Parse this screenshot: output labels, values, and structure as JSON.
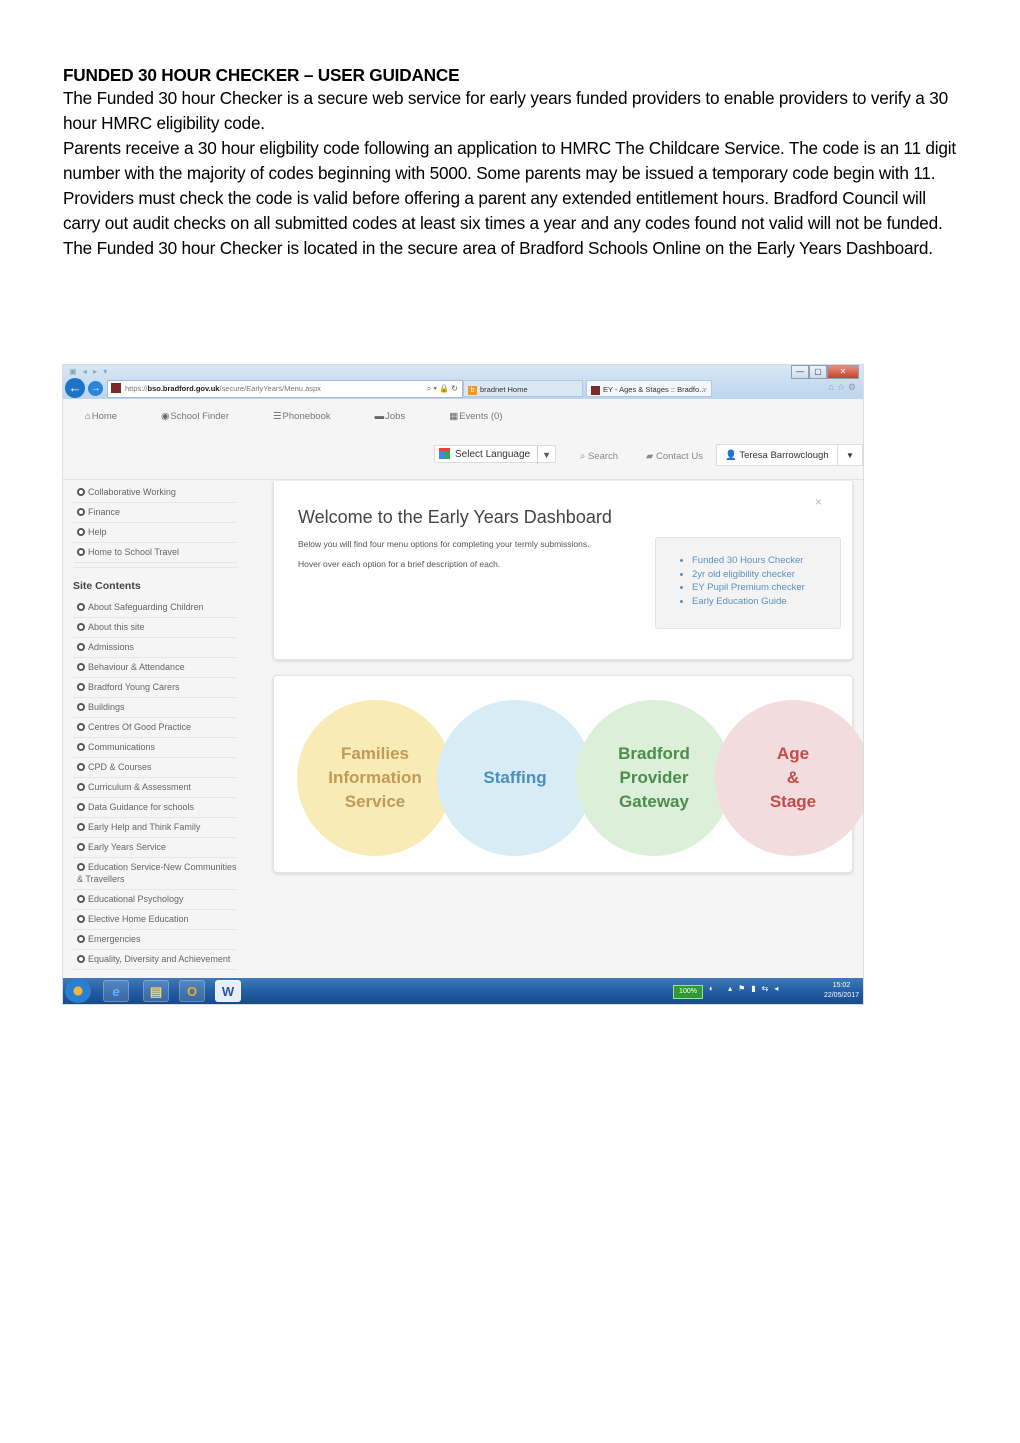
{
  "document": {
    "heading": "FUNDED 30 HOUR CHECKER – USER GUIDANCE",
    "paragraphs": [
      "The Funded 30 hour Checker is a secure web service for early years funded providers to enable providers to verify a 30 hour HMRC eligibility code.",
      "Parents receive a 30 hour eligbility code following an application to HMRC The Childcare Service. The code is an 11 digit number with the majority of codes beginning with 5000. Some parents may be issued a temporary code begin with 11.",
      "Providers must check the code is valid before offering a parent any extended entitlement hours. Bradford Council will carry out audit checks on all submitted codes  at least six times a year and any codes found not valid will not be funded.",
      "The Funded 30 hour Checker  is located in the secure area of Bradford Schools Online on the Early Years Dashboard."
    ]
  },
  "browser": {
    "url_prefix": "https://",
    "url_domain": "bso.bradford.gov.uk",
    "url_path": "/secure/EarlyYears/Menu.aspx",
    "tabs": [
      {
        "label": "bradnet Home",
        "active": false
      },
      {
        "label": "EY - Ages & Stages :: Bradfo...",
        "active": true
      }
    ],
    "window_buttons": {
      "minimize": "—",
      "maximize": "▢",
      "close": "✕"
    }
  },
  "site_nav": {
    "links": [
      {
        "icon": "home-icon",
        "glyph": "⌂",
        "label": "Home"
      },
      {
        "icon": "eye-icon",
        "glyph": "◉",
        "label": "School Finder"
      },
      {
        "icon": "list-icon",
        "glyph": "☰",
        "label": "Phonebook"
      },
      {
        "icon": "briefcase-icon",
        "glyph": "▬",
        "label": "Jobs"
      },
      {
        "icon": "calendar-icon",
        "glyph": "▦",
        "label": "Events (0)"
      }
    ],
    "language_select": "Select Language",
    "search_label": "Search",
    "contact_label": "Contact Us",
    "user_name": "Teresa Barrowclough"
  },
  "sidebar": {
    "top_items": [
      "Collaborative Working",
      "Finance",
      "Help",
      "Home to School Travel"
    ],
    "section_heading": "Site Contents",
    "items": [
      "About Safeguarding Children",
      "About this site",
      "Admissions",
      "Behaviour & Attendance",
      "Bradford Young Carers",
      "Buildings",
      "Centres Of Good Practice",
      "Communications",
      "CPD & Courses",
      "Curriculum & Assessment",
      "Data Guidance for schools",
      "Early Help and Think Family",
      "Early Years Service",
      "Education Service-New Communities & Travellers",
      "Educational Psychology",
      "Elective Home Education",
      "Emergencies",
      "Equality, Diversity and Achievement"
    ]
  },
  "welcome": {
    "title": "Welcome to the Early Years Dashboard",
    "line1": "Below you will find four menu options for completing your termly submissions.",
    "line2": "Hover over each option for a brief description of each.",
    "close": "×",
    "links": [
      "Funded 30 Hours Checker",
      "2yr old eligibility checker",
      "EY Pupil Premium checker",
      "Early Education Guide"
    ]
  },
  "menu_circles": [
    {
      "label": "Families Information Service",
      "color": "#c19a56",
      "bg": "#f8ebb5"
    },
    {
      "label": "Staffing",
      "color": "#4b8ec0",
      "bg": "#d8ecf6"
    },
    {
      "label": "Bradford Provider Gateway",
      "color": "#4c8c4c",
      "bg": "#dcefd8"
    },
    {
      "label": "Age & Stage",
      "color": "#c44b4b",
      "bg": "#f2dcdd"
    }
  ],
  "taskbar": {
    "battery": "100%",
    "time": "15:02",
    "date": "22/05/2017"
  }
}
